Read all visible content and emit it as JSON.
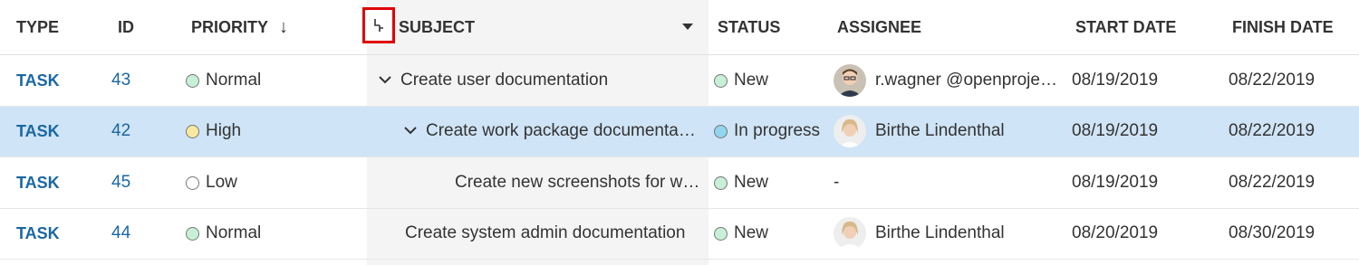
{
  "columns": {
    "type": "TYPE",
    "id": "ID",
    "priority": "PRIORITY",
    "priority_sort": "↓",
    "subject": "SUBJECT",
    "status": "STATUS",
    "assignee": "ASSIGNEE",
    "start_date": "START DATE",
    "finish_date": "FINISH DATE"
  },
  "rows": [
    {
      "type": "TASK",
      "id": "43",
      "priority": "Normal",
      "priority_color": "#c8f0d8",
      "subject": "Create user documentation",
      "indent": 0,
      "expandable": true,
      "status": "New",
      "status_color": "#c8f0d8",
      "assignee": "r.wagner @openproje…",
      "avatar": "male",
      "start": "08/19/2019",
      "finish": "08/22/2019"
    },
    {
      "type": "TASK",
      "id": "42",
      "priority": "High",
      "priority_color": "#f8e9a0",
      "subject": "Create work package documenta…",
      "indent": 1,
      "expandable": true,
      "status": "In progress",
      "status_color": "#8fd6ee",
      "assignee": "Birthe Lindenthal",
      "avatar": "female",
      "start": "08/19/2019",
      "finish": "08/22/2019"
    },
    {
      "type": "TASK",
      "id": "45",
      "priority": "Low",
      "priority_color": "#ffffff",
      "subject": "Create new screenshots for w…",
      "indent": 2,
      "expandable": false,
      "status": "New",
      "status_color": "#c8f0d8",
      "assignee": "-",
      "avatar": "none",
      "start": "08/19/2019",
      "finish": "08/22/2019"
    },
    {
      "type": "TASK",
      "id": "44",
      "priority": "Normal",
      "priority_color": "#c8f0d8",
      "subject": "Create system admin documentation",
      "indent": 0,
      "expandable": false,
      "status": "New",
      "status_color": "#c8f0d8",
      "assignee": "Birthe Lindenthal",
      "avatar": "female",
      "start": "08/20/2019",
      "finish": "08/30/2019"
    }
  ],
  "icons": {
    "hierarchy": "hierarchy-icon",
    "subject_menu": "caret-down-icon",
    "expand": "chevron-down-icon"
  },
  "colors": {
    "link": "#1a67a3",
    "highlight_row": "#cfe4f6",
    "annotation": "#e00000"
  }
}
